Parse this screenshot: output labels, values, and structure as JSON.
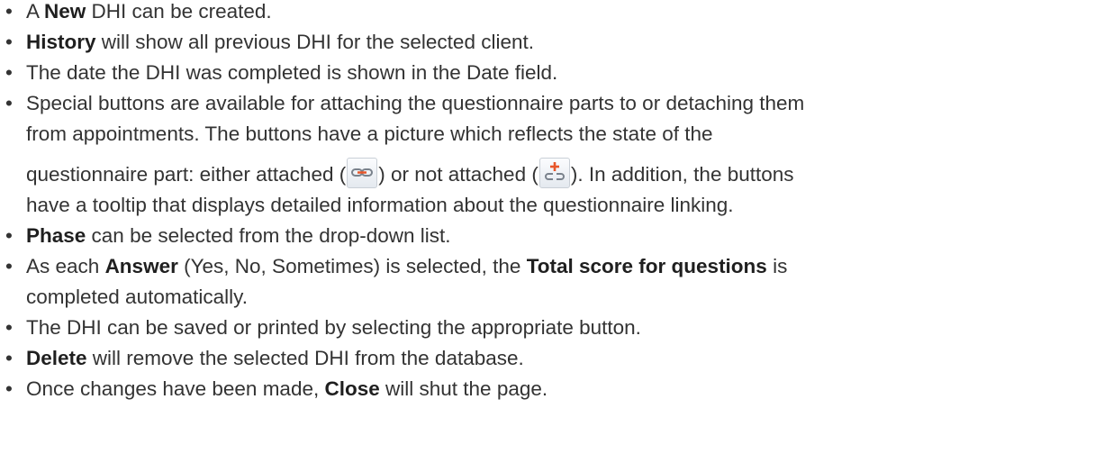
{
  "bullets": {
    "b1": {
      "pre": "A ",
      "bold": "New",
      "post": " DHI can be created."
    },
    "b2": {
      "bold": "History",
      "post": " will show all previous DHI for the selected client."
    },
    "b3": {
      "text": "The date the DHI was completed is shown in the Date field."
    },
    "b4": {
      "line1": "Special buttons are available for attaching the questionnaire parts to or detaching them",
      "line2": "from appointments. The buttons have a picture which reflects the state of the",
      "line3a": "questionnaire part: either attached (",
      "line3b": ") or not attached (",
      "line3c": "). In addition, the buttons",
      "line4": "have a tooltip that displays detailed information about the questionnaire linking.",
      "icon_attached": "link-attached-icon",
      "icon_not_attached": "link-add-icon"
    },
    "b5": {
      "bold": "Phase",
      "post": " can be selected from the drop-down list."
    },
    "b6": {
      "pre": "As each ",
      "bold1": "Answer",
      "mid": " (Yes, No, Sometimes) is selected, the ",
      "bold2": "Total score for questions",
      "post": " is",
      "line2": "completed automatically."
    },
    "b7": {
      "text": "The DHI can be saved or printed by selecting the appropriate button."
    },
    "b8": {
      "bold": "Delete",
      "post": " will remove the selected DHI from the database."
    },
    "b9": {
      "pre": "Once changes have been made, ",
      "bold": "Close",
      "post": " will shut the page."
    }
  },
  "colors": {
    "text": "#333333",
    "icon_orange": "#e8562a",
    "icon_gray": "#7a828c"
  }
}
